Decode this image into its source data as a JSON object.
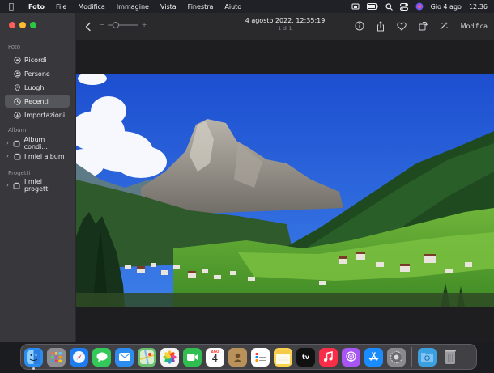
{
  "menubar": {
    "app_name": "Foto",
    "menus": [
      "File",
      "Modifica",
      "Immagine",
      "Vista",
      "Finestra",
      "Aiuto"
    ],
    "date": "Gio 4 ago",
    "time": "12:36",
    "status_icons": [
      "screen-mirroring-icon",
      "battery-icon",
      "search-icon",
      "control-center-icon",
      "siri-icon"
    ]
  },
  "window": {
    "traffic_colors": [
      "#ff5f57",
      "#febc2e",
      "#28c840"
    ]
  },
  "sidebar": {
    "sections": {
      "library": "Foto",
      "albums": "Album",
      "projects": "Progetti"
    },
    "library_items": [
      {
        "label": "Ricordi",
        "icon": "memories-icon",
        "selected": false
      },
      {
        "label": "Persone",
        "icon": "people-icon",
        "selected": false
      },
      {
        "label": "Luoghi",
        "icon": "places-icon",
        "selected": false
      },
      {
        "label": "Recenti",
        "icon": "recents-icon",
        "selected": true
      },
      {
        "label": "Importazioni",
        "icon": "imports-icon",
        "selected": false
      }
    ],
    "album_items": [
      {
        "label": "Album condi...",
        "icon": "shared-album-icon"
      },
      {
        "label": "I miei album",
        "icon": "album-folder-icon"
      }
    ],
    "project_items": [
      {
        "label": "I miei progetti",
        "icon": "project-folder-icon"
      }
    ]
  },
  "toolbar": {
    "title": "4 agosto 2022, 12:35:19",
    "subtitle": "1 di 1",
    "zoom_minus": "−",
    "zoom_plus": "+",
    "zoom_level": 0.2,
    "edit_label": "Modifica"
  },
  "dock": {
    "apps": [
      {
        "name": "finder",
        "bg": "#2a8cf0",
        "label": ""
      },
      {
        "name": "launchpad",
        "bg": "#8e8e93",
        "label": ""
      },
      {
        "name": "safari",
        "bg": "#1e7cf2",
        "label": ""
      },
      {
        "name": "messages",
        "bg": "#34c759",
        "label": ""
      },
      {
        "name": "mail",
        "bg": "#2d8cf0",
        "label": ""
      },
      {
        "name": "maps",
        "bg": "#6cc070",
        "label": ""
      },
      {
        "name": "photos",
        "bg": "#f4f4f4",
        "label": ""
      },
      {
        "name": "facetime",
        "bg": "#2fbe4f",
        "label": ""
      },
      {
        "name": "calendar",
        "bg": "#ffffff",
        "label": "4",
        "month": "AGO"
      },
      {
        "name": "contacts",
        "bg": "#b8925a",
        "label": ""
      },
      {
        "name": "reminders",
        "bg": "#ffffff",
        "label": ""
      },
      {
        "name": "notes",
        "bg": "#fcd34d",
        "label": ""
      },
      {
        "name": "apple-tv",
        "bg": "#111111",
        "label": "tv"
      },
      {
        "name": "music",
        "bg": "#fa2d48",
        "label": ""
      },
      {
        "name": "podcasts",
        "bg": "#a855f7",
        "label": ""
      },
      {
        "name": "app-store",
        "bg": "#1a8cff",
        "label": ""
      },
      {
        "name": "system-preferences",
        "bg": "#8a8a8e",
        "label": ""
      },
      {
        "name": "downloads-folder",
        "bg": "#3aa0e0",
        "label": ""
      },
      {
        "name": "trash",
        "bg": "transparent",
        "label": ""
      }
    ]
  }
}
